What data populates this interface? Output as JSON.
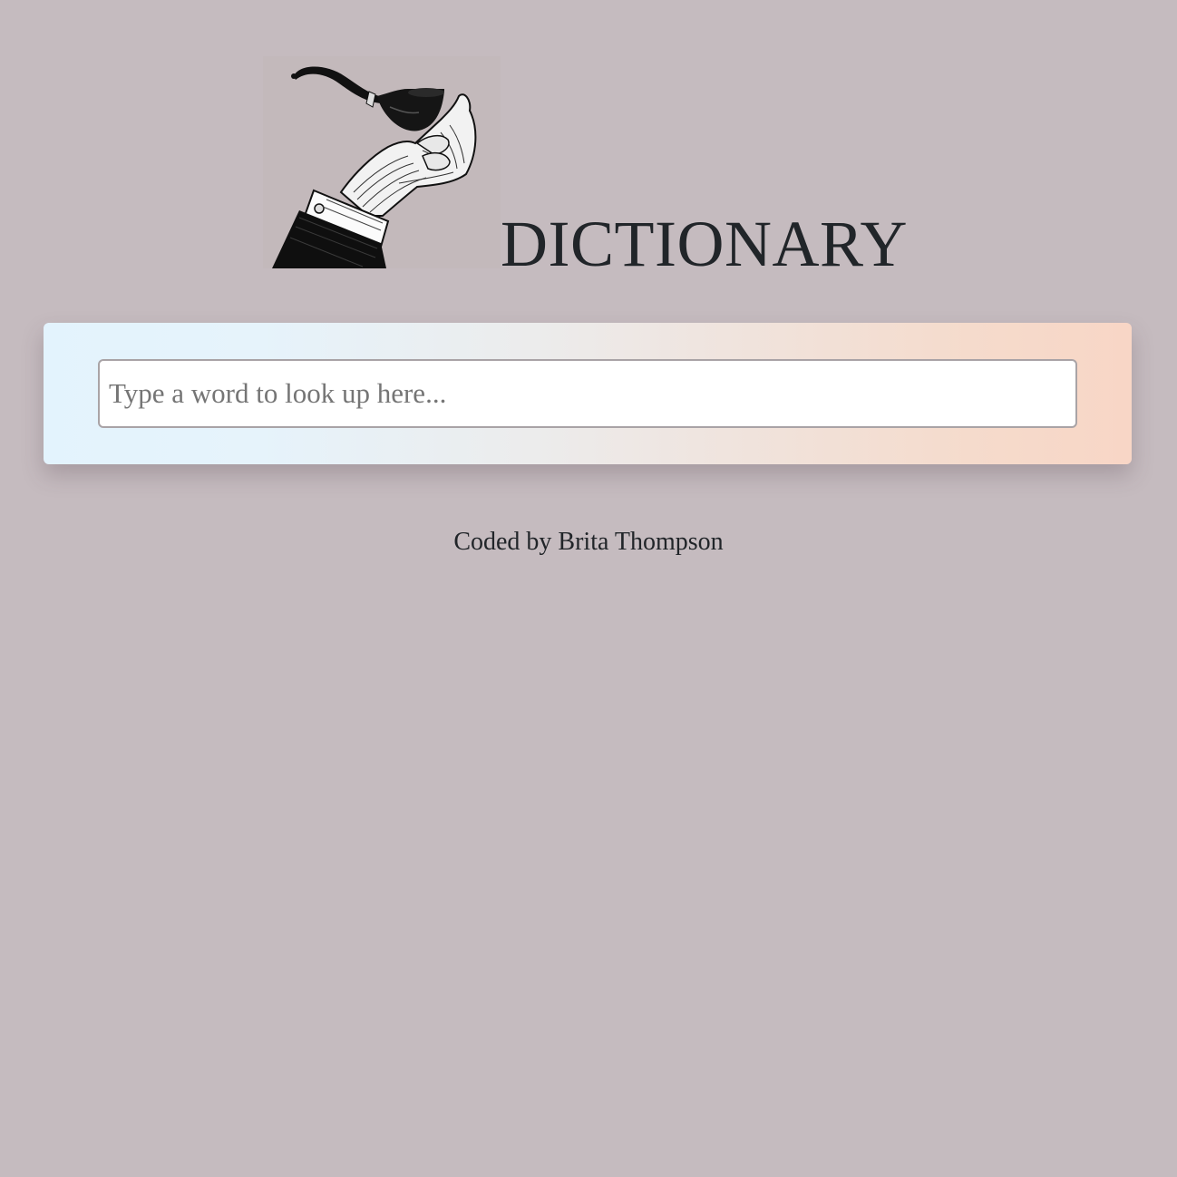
{
  "header": {
    "logo_icon": "hand-holding-pipe-engraving",
    "title": "DICTIONARY"
  },
  "search": {
    "placeholder": "Type a word to look up here...",
    "value": ""
  },
  "footer": {
    "credit": "Coded by Brita Thompson"
  },
  "colors": {
    "background": "#c5bbbf",
    "text": "#212529",
    "card_gradient_start": "#e3f3fd",
    "card_gradient_end": "#f8d6c6"
  }
}
